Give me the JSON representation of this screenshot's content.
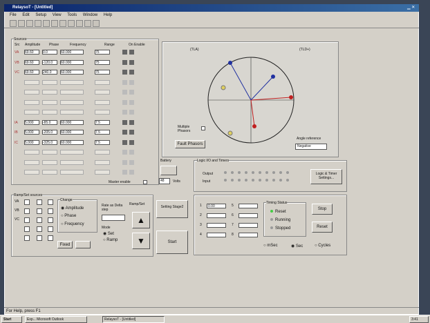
{
  "window": {
    "title": "RelaysoT - [Untitled]"
  },
  "menu": [
    "File",
    "Edit",
    "Setup",
    "View",
    "Tools",
    "Window",
    "Help"
  ],
  "sources": {
    "group_label": "Sources",
    "headers": [
      "Src",
      "Amplitude",
      "Phase",
      "Frequency",
      "Range",
      "On Enable"
    ],
    "rows": [
      {
        "name": "VA",
        "amp": "69.60",
        "phase": "0.0",
        "freq": "60.000",
        "range": "75",
        "enabled": true
      },
      {
        "name": "VB",
        "amp": "69.60",
        "phase": "-120.0",
        "freq": "60.000",
        "range": "75",
        "enabled": true
      },
      {
        "name": "VC",
        "amp": "69.60",
        "phase": "240.0",
        "freq": "60.000",
        "range": "75",
        "enabled": true
      },
      {
        "name": "",
        "amp": "",
        "phase": "",
        "freq": "",
        "range": "",
        "enabled": false
      },
      {
        "name": "",
        "amp": "",
        "phase": "",
        "freq": "",
        "range": "",
        "enabled": false
      },
      {
        "name": "",
        "amp": "",
        "phase": "",
        "freq": "",
        "range": "",
        "enabled": false
      },
      {
        "name": "",
        "amp": "",
        "phase": "",
        "freq": "",
        "range": "",
        "enabled": false
      },
      {
        "name": "IA",
        "amp": "5.000",
        "phase": "-85.0",
        "freq": "60.000",
        "range": "7.5",
        "enabled": true
      },
      {
        "name": "IB",
        "amp": "5.000",
        "phase": "-205.0",
        "freq": "60.000",
        "range": "7.5",
        "enabled": true
      },
      {
        "name": "IC",
        "amp": "5.000",
        "phase": "-325.0",
        "freq": "60.000",
        "range": "7.5",
        "enabled": true
      },
      {
        "name": "",
        "amp": "",
        "phase": "",
        "freq": "",
        "range": "",
        "enabled": false
      },
      {
        "name": "",
        "amp": "",
        "phase": "",
        "freq": "",
        "range": "",
        "enabled": false
      },
      {
        "name": "",
        "amp": "",
        "phase": "",
        "freq": "",
        "range": "",
        "enabled": false
      }
    ],
    "master_enable": "Master enable"
  },
  "phasor": {
    "left_label": "(TLA)",
    "right_label": "(TLD+)",
    "multiple_phasors": "Multiple Phasors",
    "fault_phasors": "Fault Phasors",
    "angle_reference": "Angle reference",
    "angle_value": "Negative"
  },
  "battery": {
    "label": "Battery",
    "value": "48",
    "unit": "Volts"
  },
  "ramp": {
    "group_label": "Ramp/Set sources",
    "change_label": "Change",
    "opts": [
      "Amplitude",
      "Phase",
      "Frequency"
    ],
    "rate_label": "Rate as Delta step",
    "ramp_set": "Ramp/Set",
    "mode_label": "Mode",
    "mode_opts": [
      "Set",
      "Ramp"
    ],
    "rows": [
      "VA",
      "VB",
      "VC",
      "",
      ""
    ],
    "fixed": "Fixed",
    "step_label": "Setting Stage2"
  },
  "logic": {
    "group_label": "Logic I/O and Timers",
    "output": "Output",
    "input": "Input",
    "settings_btn": "Logic & Timer Settings..."
  },
  "timing": {
    "first_value": "0.00",
    "status_label": "Timing Status",
    "status": [
      "Reset",
      "Running",
      "Stopped"
    ],
    "stop": "Stop",
    "reset": "Reset",
    "units": [
      "mSec",
      "Sec",
      "Cycles"
    ]
  },
  "start": "Start",
  "statusbar": "For Help, press F1",
  "taskbar": {
    "start": "Start",
    "items": [
      "Exp... Microsoft Outlook",
      "RelaysoT - [Untitled]"
    ],
    "clock": "3:41"
  }
}
